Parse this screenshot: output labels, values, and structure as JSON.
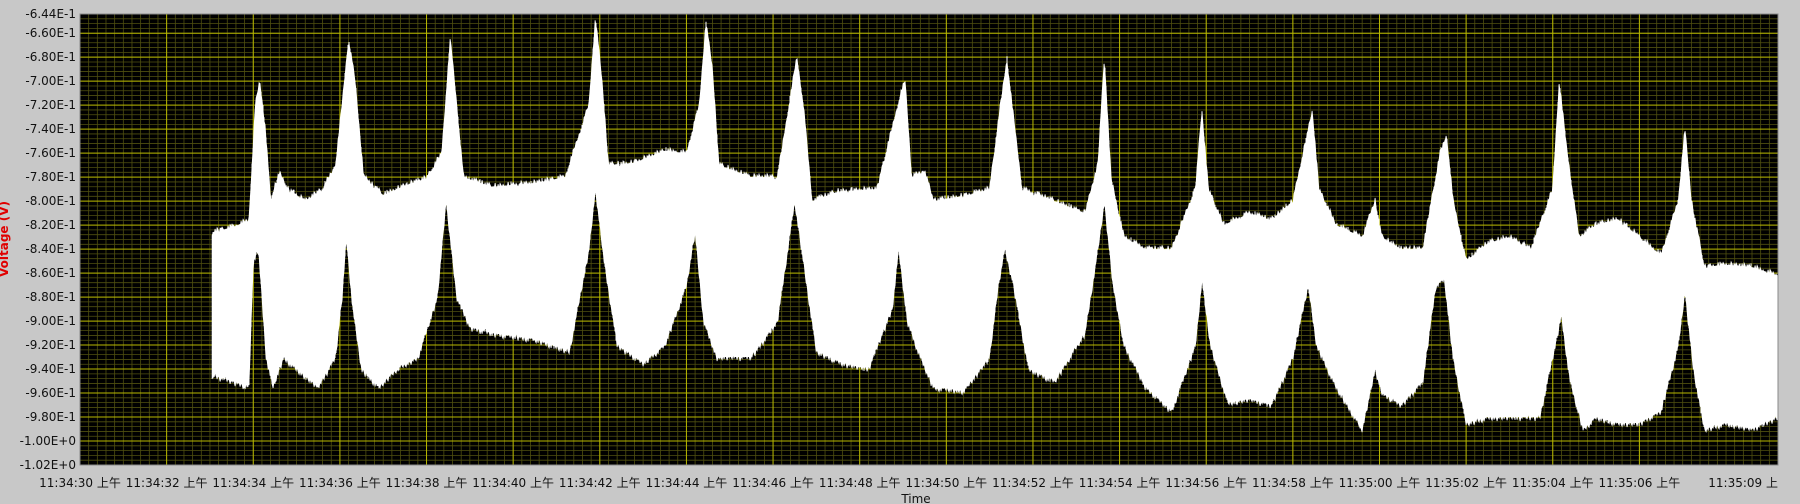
{
  "chart_data": {
    "type": "line",
    "title": "",
    "xlabel": "Time",
    "ylabel": "Voltage (V)",
    "ylim": [
      -1.02,
      -0.644
    ],
    "y_ticks": [
      {
        "value": -0.644,
        "label": "-6.44E-1"
      },
      {
        "value": -0.66,
        "label": "-6.60E-1"
      },
      {
        "value": -0.68,
        "label": "-6.80E-1"
      },
      {
        "value": -0.7,
        "label": "-7.00E-1"
      },
      {
        "value": -0.72,
        "label": "-7.20E-1"
      },
      {
        "value": -0.74,
        "label": "-7.40E-1"
      },
      {
        "value": -0.76,
        "label": "-7.60E-1"
      },
      {
        "value": -0.78,
        "label": "-7.80E-1"
      },
      {
        "value": -0.8,
        "label": "-8.00E-1"
      },
      {
        "value": -0.82,
        "label": "-8.20E-1"
      },
      {
        "value": -0.84,
        "label": "-8.40E-1"
      },
      {
        "value": -0.86,
        "label": "-8.60E-1"
      },
      {
        "value": -0.88,
        "label": "-8.80E-1"
      },
      {
        "value": -0.9,
        "label": "-9.00E-1"
      },
      {
        "value": -0.92,
        "label": "-9.20E-1"
      },
      {
        "value": -0.94,
        "label": "-9.40E-1"
      },
      {
        "value": -0.96,
        "label": "-9.60E-1"
      },
      {
        "value": -0.98,
        "label": "-9.80E-1"
      },
      {
        "value": -1.0,
        "label": "-1.00E+0"
      },
      {
        "value": -1.02,
        "label": "-1.02E+0"
      }
    ],
    "x_ticks": [
      {
        "value": 0,
        "label": "11:34:30 上午"
      },
      {
        "value": 2,
        "label": "11:34:32 上午"
      },
      {
        "value": 4,
        "label": "11:34:34 上午"
      },
      {
        "value": 6,
        "label": "11:34:36 上午"
      },
      {
        "value": 8,
        "label": "11:34:38 上午"
      },
      {
        "value": 10,
        "label": "11:34:40 上午"
      },
      {
        "value": 12,
        "label": "11:34:42 上午"
      },
      {
        "value": 14,
        "label": "11:34:44 上午"
      },
      {
        "value": 16,
        "label": "11:34:46 上午"
      },
      {
        "value": 18,
        "label": "11:34:48 上午"
      },
      {
        "value": 20,
        "label": "11:34:50 上午"
      },
      {
        "value": 22,
        "label": "11:34:52 上午"
      },
      {
        "value": 24,
        "label": "11:34:54 上午"
      },
      {
        "value": 26,
        "label": "11:34:56 上午"
      },
      {
        "value": 28,
        "label": "11:34:58 上午"
      },
      {
        "value": 30,
        "label": "11:35:00 上午"
      },
      {
        "value": 32,
        "label": "11:35:02 上午"
      },
      {
        "value": 34,
        "label": "11:35:04 上午"
      },
      {
        "value": 36,
        "label": "11:35:06 上午"
      },
      {
        "value": 39.2,
        "label": "11:35:09 上"
      }
    ],
    "xlim": [
      0,
      39.2
    ],
    "grid": true,
    "colors": {
      "plot_background": "#000000",
      "major_grid": "#b8b800",
      "minor_grid": "#4f4f10",
      "trace": "#ffffff",
      "frame": "#c8c8c8",
      "ylabel": "#e00000"
    },
    "series": [
      {
        "start": 3.05,
        "end": 39.2,
        "upper_envelope": [
          [
            3.05,
            -0.826
          ],
          [
            3.5,
            -0.822
          ],
          [
            3.9,
            -0.816
          ],
          [
            4.05,
            -0.72
          ],
          [
            4.15,
            -0.7
          ],
          [
            4.28,
            -0.74
          ],
          [
            4.4,
            -0.8
          ],
          [
            4.6,
            -0.776
          ],
          [
            4.8,
            -0.79
          ],
          [
            5.2,
            -0.8
          ],
          [
            5.6,
            -0.79
          ],
          [
            5.9,
            -0.77
          ],
          [
            6.05,
            -0.72
          ],
          [
            6.2,
            -0.665
          ],
          [
            6.35,
            -0.7
          ],
          [
            6.55,
            -0.78
          ],
          [
            7.0,
            -0.795
          ],
          [
            7.5,
            -0.787
          ],
          [
            8.0,
            -0.781
          ],
          [
            8.35,
            -0.76
          ],
          [
            8.55,
            -0.665
          ],
          [
            8.7,
            -0.72
          ],
          [
            8.85,
            -0.78
          ],
          [
            9.5,
            -0.788
          ],
          [
            10.5,
            -0.785
          ],
          [
            11.2,
            -0.78
          ],
          [
            11.75,
            -0.72
          ],
          [
            11.9,
            -0.647
          ],
          [
            12.05,
            -0.7
          ],
          [
            12.2,
            -0.77
          ],
          [
            12.8,
            -0.768
          ],
          [
            13.5,
            -0.758
          ],
          [
            14.0,
            -0.76
          ],
          [
            14.3,
            -0.72
          ],
          [
            14.45,
            -0.651
          ],
          [
            14.6,
            -0.69
          ],
          [
            14.75,
            -0.77
          ],
          [
            15.5,
            -0.78
          ],
          [
            16.1,
            -0.78
          ],
          [
            16.55,
            -0.68
          ],
          [
            16.7,
            -0.72
          ],
          [
            16.9,
            -0.8
          ],
          [
            17.5,
            -0.792
          ],
          [
            18.4,
            -0.79
          ],
          [
            18.95,
            -0.71
          ],
          [
            19.05,
            -0.7
          ],
          [
            19.2,
            -0.78
          ],
          [
            19.5,
            -0.775
          ],
          [
            19.7,
            -0.8
          ],
          [
            20.5,
            -0.795
          ],
          [
            21.0,
            -0.79
          ],
          [
            21.25,
            -0.72
          ],
          [
            21.4,
            -0.682
          ],
          [
            21.55,
            -0.73
          ],
          [
            21.75,
            -0.79
          ],
          [
            22.5,
            -0.8
          ],
          [
            23.2,
            -0.81
          ],
          [
            23.5,
            -0.77
          ],
          [
            23.65,
            -0.68
          ],
          [
            23.8,
            -0.78
          ],
          [
            24.1,
            -0.83
          ],
          [
            24.6,
            -0.84
          ],
          [
            25.2,
            -0.84
          ],
          [
            25.75,
            -0.79
          ],
          [
            25.9,
            -0.725
          ],
          [
            26.05,
            -0.79
          ],
          [
            26.4,
            -0.82
          ],
          [
            27.0,
            -0.81
          ],
          [
            27.5,
            -0.816
          ],
          [
            28.0,
            -0.8
          ],
          [
            28.45,
            -0.725
          ],
          [
            28.6,
            -0.79
          ],
          [
            29.0,
            -0.82
          ],
          [
            29.6,
            -0.83
          ],
          [
            29.9,
            -0.8
          ],
          [
            30.05,
            -0.83
          ],
          [
            30.5,
            -0.84
          ],
          [
            31.0,
            -0.84
          ],
          [
            31.4,
            -0.76
          ],
          [
            31.55,
            -0.745
          ],
          [
            31.7,
            -0.8
          ],
          [
            32.0,
            -0.85
          ],
          [
            32.5,
            -0.835
          ],
          [
            33.0,
            -0.83
          ],
          [
            33.5,
            -0.84
          ],
          [
            34.0,
            -0.79
          ],
          [
            34.15,
            -0.7
          ],
          [
            34.3,
            -0.75
          ],
          [
            34.6,
            -0.83
          ],
          [
            35.0,
            -0.82
          ],
          [
            35.5,
            -0.815
          ],
          [
            36.0,
            -0.83
          ],
          [
            36.5,
            -0.845
          ],
          [
            36.9,
            -0.8
          ],
          [
            37.05,
            -0.74
          ],
          [
            37.2,
            -0.8
          ],
          [
            37.5,
            -0.855
          ],
          [
            38.0,
            -0.853
          ],
          [
            38.6,
            -0.855
          ],
          [
            39.2,
            -0.862
          ]
        ],
        "lower_envelope": [
          [
            3.05,
            -0.945
          ],
          [
            3.5,
            -0.95
          ],
          [
            3.9,
            -0.955
          ],
          [
            4.0,
            -0.85
          ],
          [
            4.12,
            -0.84
          ],
          [
            4.3,
            -0.93
          ],
          [
            4.45,
            -0.955
          ],
          [
            4.7,
            -0.93
          ],
          [
            5.0,
            -0.94
          ],
          [
            5.5,
            -0.955
          ],
          [
            5.9,
            -0.93
          ],
          [
            6.05,
            -0.88
          ],
          [
            6.15,
            -0.83
          ],
          [
            6.3,
            -0.89
          ],
          [
            6.5,
            -0.94
          ],
          [
            6.9,
            -0.955
          ],
          [
            7.3,
            -0.94
          ],
          [
            7.8,
            -0.93
          ],
          [
            8.25,
            -0.88
          ],
          [
            8.45,
            -0.8
          ],
          [
            8.7,
            -0.88
          ],
          [
            9.0,
            -0.905
          ],
          [
            9.5,
            -0.91
          ],
          [
            10.5,
            -0.915
          ],
          [
            11.3,
            -0.925
          ],
          [
            11.75,
            -0.84
          ],
          [
            11.9,
            -0.79
          ],
          [
            12.1,
            -0.85
          ],
          [
            12.4,
            -0.92
          ],
          [
            13.0,
            -0.935
          ],
          [
            13.5,
            -0.92
          ],
          [
            14.0,
            -0.87
          ],
          [
            14.2,
            -0.825
          ],
          [
            14.4,
            -0.9
          ],
          [
            14.7,
            -0.93
          ],
          [
            15.5,
            -0.93
          ],
          [
            16.1,
            -0.9
          ],
          [
            16.5,
            -0.8
          ],
          [
            16.7,
            -0.85
          ],
          [
            17.0,
            -0.925
          ],
          [
            17.6,
            -0.935
          ],
          [
            18.2,
            -0.94
          ],
          [
            18.75,
            -0.89
          ],
          [
            18.9,
            -0.84
          ],
          [
            19.1,
            -0.9
          ],
          [
            19.4,
            -0.93
          ],
          [
            19.7,
            -0.955
          ],
          [
            20.4,
            -0.958
          ],
          [
            21.0,
            -0.93
          ],
          [
            21.2,
            -0.87
          ],
          [
            21.35,
            -0.84
          ],
          [
            21.55,
            -0.87
          ],
          [
            21.9,
            -0.94
          ],
          [
            22.5,
            -0.95
          ],
          [
            23.2,
            -0.91
          ],
          [
            23.5,
            -0.84
          ],
          [
            23.65,
            -0.8
          ],
          [
            23.85,
            -0.87
          ],
          [
            24.1,
            -0.92
          ],
          [
            24.6,
            -0.955
          ],
          [
            25.2,
            -0.975
          ],
          [
            25.75,
            -0.92
          ],
          [
            25.9,
            -0.865
          ],
          [
            26.1,
            -0.92
          ],
          [
            26.5,
            -0.968
          ],
          [
            27.0,
            -0.965
          ],
          [
            27.5,
            -0.97
          ],
          [
            28.0,
            -0.93
          ],
          [
            28.35,
            -0.87
          ],
          [
            28.55,
            -0.92
          ],
          [
            29.0,
            -0.955
          ],
          [
            29.6,
            -0.99
          ],
          [
            29.9,
            -0.94
          ],
          [
            30.05,
            -0.96
          ],
          [
            30.5,
            -0.97
          ],
          [
            31.0,
            -0.95
          ],
          [
            31.3,
            -0.87
          ],
          [
            31.5,
            -0.865
          ],
          [
            31.7,
            -0.93
          ],
          [
            32.0,
            -0.985
          ],
          [
            32.5,
            -0.98
          ],
          [
            33.0,
            -0.98
          ],
          [
            33.7,
            -0.98
          ],
          [
            34.0,
            -0.93
          ],
          [
            34.2,
            -0.895
          ],
          [
            34.4,
            -0.95
          ],
          [
            34.7,
            -0.99
          ],
          [
            35.0,
            -0.98
          ],
          [
            35.5,
            -0.985
          ],
          [
            36.0,
            -0.985
          ],
          [
            36.5,
            -0.975
          ],
          [
            36.9,
            -0.92
          ],
          [
            37.05,
            -0.875
          ],
          [
            37.25,
            -0.94
          ],
          [
            37.5,
            -0.99
          ],
          [
            38.0,
            -0.985
          ],
          [
            38.6,
            -0.99
          ],
          [
            39.2,
            -0.98
          ]
        ]
      }
    ]
  }
}
